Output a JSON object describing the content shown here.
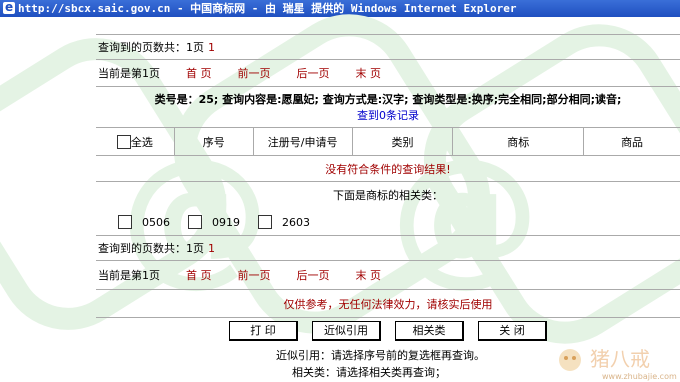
{
  "window": {
    "title": "http://sbcx.saic.gov.cn - 中国商标网 - 由 瑞星 提供的 Windows Internet Explorer"
  },
  "top": {
    "pages_found_label": "查询到的页数共：1页",
    "pages_found_value": "1",
    "current_page_label": "当前是第1页",
    "nav": [
      "首 页",
      "前一页",
      "后一页",
      "末 页"
    ]
  },
  "query_summary": "类号是：25; 查询内容是:愿凰妃; 查询方式是:汉字; 查询类型是:换序;完全相同;部分相同;读音;",
  "records_found": "查到0条记录",
  "table": {
    "select_all": "全选",
    "columns": [
      "序号",
      "注册号/申请号",
      "类别",
      "商标",
      "商品"
    ]
  },
  "no_result": "没有符合条件的查询结果!",
  "related_title": "下面是商标的相关类：",
  "related_classes": [
    "0506",
    "0919",
    "2603"
  ],
  "bottom": {
    "pages_found_label": "查询到的页数共：1页",
    "pages_found_value": "1",
    "current_page_label": "当前是第1页",
    "nav": [
      "首 页",
      "前一页",
      "后一页",
      "末 页"
    ]
  },
  "disclaimer": "仅供参考，无任何法律效力，请核实后使用",
  "buttons": [
    "打 印",
    "近似引用",
    "相关类",
    "关 闭"
  ],
  "help": [
    "近似引用：请选择序号前的复选框再查询。",
    "相关类：请选择相关类再查询；"
  ],
  "watermark": {
    "brand": "猪八戒",
    "url": "www.zhubajie.com"
  }
}
